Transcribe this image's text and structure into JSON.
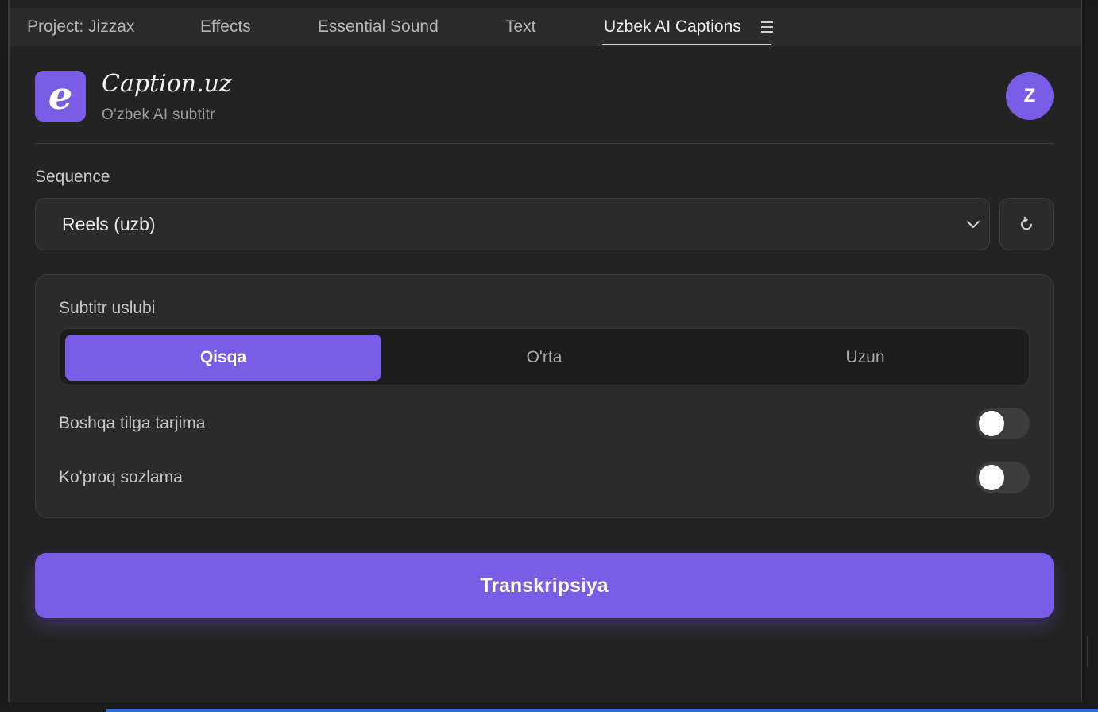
{
  "tabs": [
    {
      "label": "Project: Jizzax"
    },
    {
      "label": "Effects"
    },
    {
      "label": "Essential Sound"
    },
    {
      "label": "Text"
    },
    {
      "label": "Uzbek AI Captions",
      "active": true
    }
  ],
  "icons": {
    "menu": "hamburger-icon",
    "logo": "caption-logo-icon",
    "dropdown": "chevron-down-icon",
    "refresh": "refresh-icon"
  },
  "brand": {
    "logo_letter": "e",
    "title": "Caption.uz",
    "subtitle": "O'zbek AI subtitr"
  },
  "user": {
    "avatar_letter": "Z"
  },
  "sequence": {
    "label": "Sequence",
    "selected": "Reels (uzb)"
  },
  "style_card": {
    "title": "Subtitr uslubi",
    "options": [
      "Qisqa",
      "O'rta",
      "Uzun"
    ],
    "selected": "Qisqa"
  },
  "toggles": [
    {
      "label": "Boshqa tilga tarjima",
      "on": false
    },
    {
      "label": "Ko'proq sozlama",
      "on": false
    }
  ],
  "action": {
    "label": "Transkripsiya"
  },
  "colors": {
    "accent": "#7a5ce6",
    "background": "#232323",
    "surface": "#2b2b2b"
  }
}
